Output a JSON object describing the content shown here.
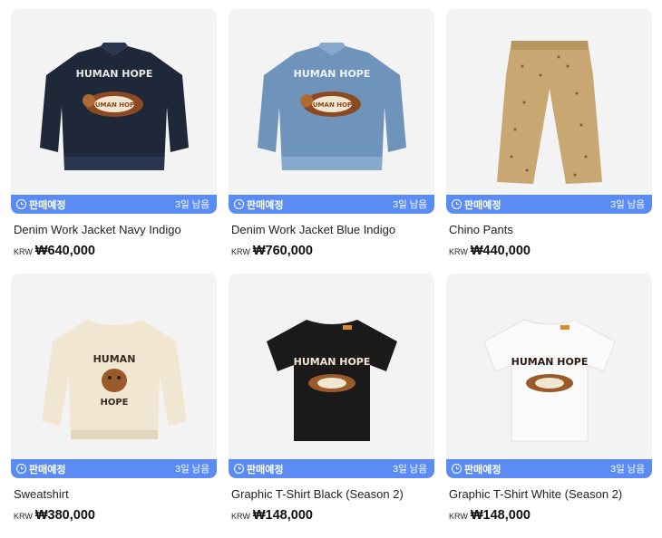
{
  "products": [
    {
      "name": "Denim Work Jacket Navy Indigo",
      "currency": "KRW",
      "price": "₩640,000",
      "status": "판매예정",
      "remaining": "3일 남음",
      "image_type": "jacket",
      "garment_color": "#1f2838",
      "garment_shade": "#2b3650",
      "print_text": "HUMAN HOPE"
    },
    {
      "name": "Denim Work Jacket Blue Indigo",
      "currency": "KRW",
      "price": "₩760,000",
      "status": "판매예정",
      "remaining": "3일 남음",
      "image_type": "jacket",
      "garment_color": "#6f94bb",
      "garment_shade": "#86a9cc",
      "print_text": "HUMAN HOPE"
    },
    {
      "name": "Chino Pants",
      "currency": "KRW",
      "price": "₩440,000",
      "status": "판매예정",
      "remaining": "3일 남음",
      "image_type": "pants",
      "garment_color": "#c9a772",
      "garment_shade": "#b8955f",
      "print_text": ""
    },
    {
      "name": "Sweatshirt",
      "currency": "KRW",
      "price": "₩380,000",
      "status": "판매예정",
      "remaining": "3일 남음",
      "image_type": "sweatshirt",
      "garment_color": "#f1e6d1",
      "garment_shade": "#e4d6bc",
      "print_text": "HUMAN HOPE"
    },
    {
      "name": "Graphic T-Shirt Black (Season 2)",
      "currency": "KRW",
      "price": "₩148,000",
      "status": "판매예정",
      "remaining": "3일 남음",
      "image_type": "tshirt",
      "garment_color": "#1a1a1a",
      "garment_shade": "#2a2a2a",
      "print_text": "HUMAN HOPE"
    },
    {
      "name": "Graphic T-Shirt White (Season 2)",
      "currency": "KRW",
      "price": "₩148,000",
      "status": "판매예정",
      "remaining": "3일 남음",
      "image_type": "tshirt",
      "garment_color": "#fafafa",
      "garment_shade": "#ececec",
      "print_text": "HUMAN HOPE"
    }
  ],
  "accent_color": "#5b8cf5"
}
